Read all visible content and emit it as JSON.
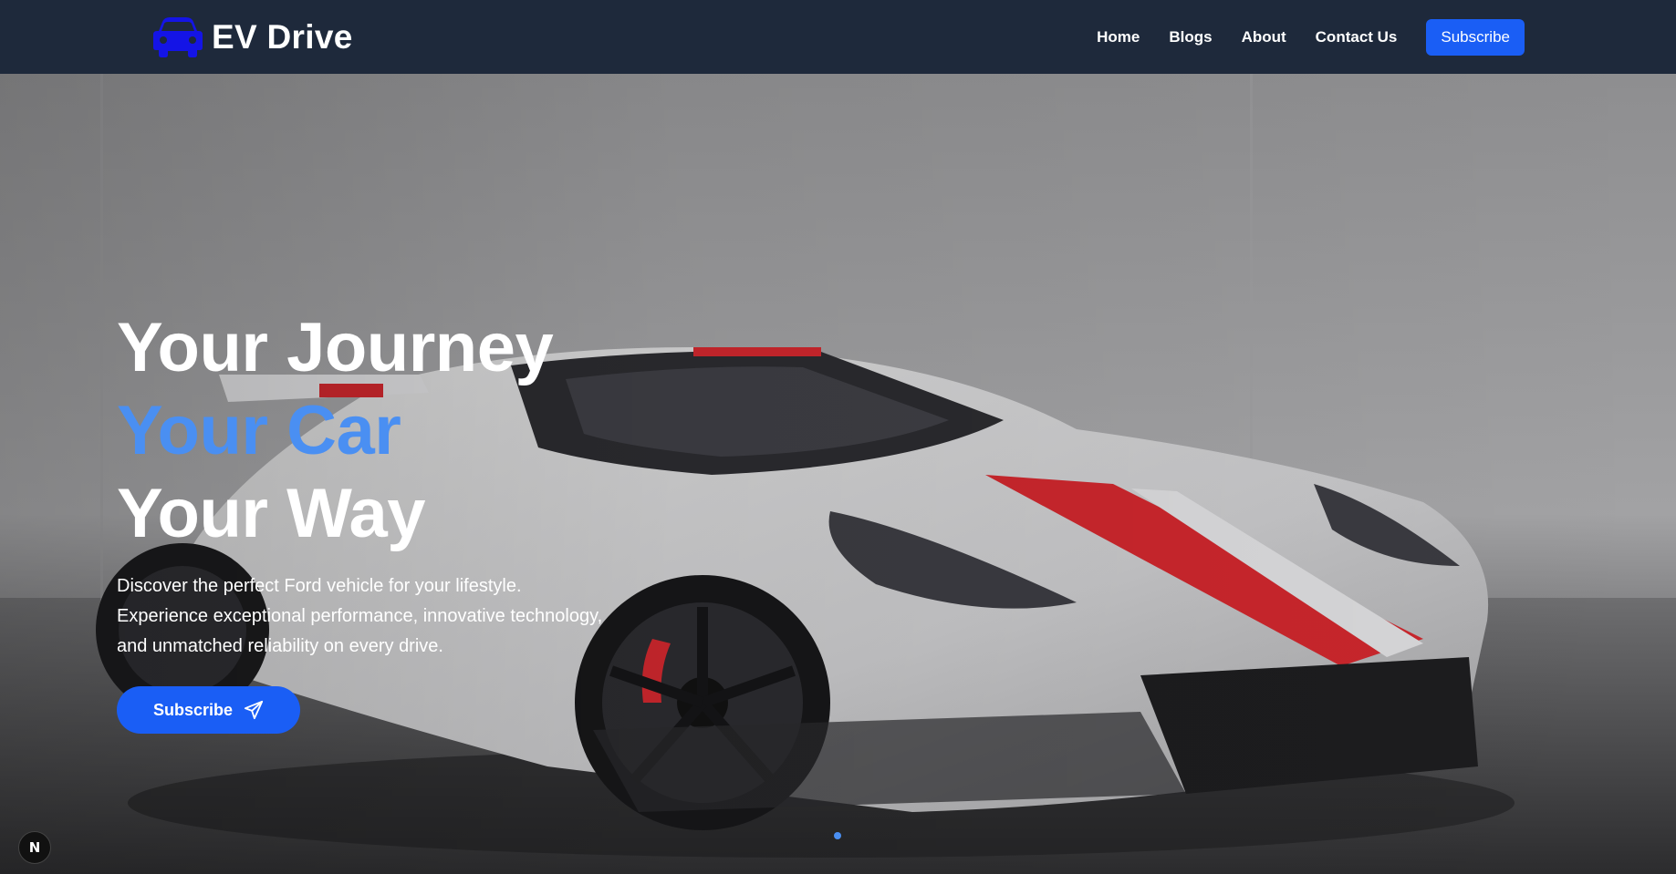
{
  "brand": {
    "name": "EV Drive",
    "icon": "car-icon",
    "icon_color": "#1414e6"
  },
  "nav": {
    "links": [
      "Home",
      "Blogs",
      "About",
      "Contact Us"
    ],
    "subscribe_label": "Subscribe"
  },
  "hero": {
    "headline": [
      "Your Journey",
      "Your Car",
      "Your Way"
    ],
    "description": [
      "Discover the perfect Ford vehicle for your lifestyle.",
      "Experience exceptional performance, innovative technology,",
      "and unmatched reliability on every drive."
    ],
    "cta_label": "Subscribe",
    "cta_icon": "send-icon",
    "slide_count": 1,
    "active_slide": 1
  },
  "dev_badge": {
    "label": "N"
  },
  "colors": {
    "navbar_bg": "#1e293b",
    "primary": "#1a5ef5",
    "accent_text": "#4a8ff2",
    "text": "#ffffff"
  }
}
